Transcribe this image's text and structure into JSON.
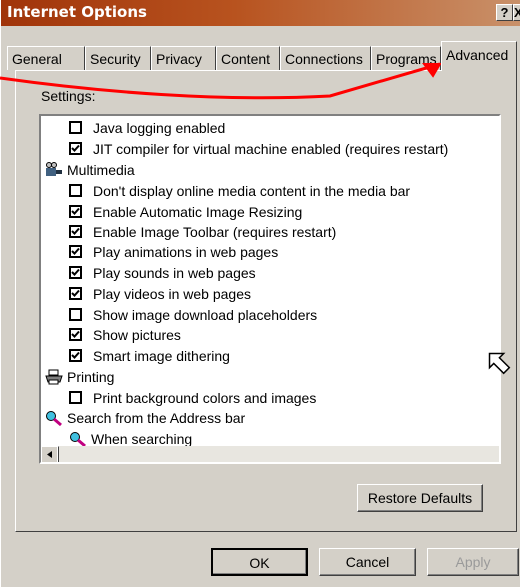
{
  "window": {
    "title": "Internet Options",
    "help_label": "?",
    "close_label": "X"
  },
  "tabs": [
    {
      "label": "General"
    },
    {
      "label": "Security"
    },
    {
      "label": "Privacy"
    },
    {
      "label": "Content"
    },
    {
      "label": "Connections"
    },
    {
      "label": "Programs"
    },
    {
      "label": "Advanced"
    }
  ],
  "active_tab": "Advanced",
  "settings_label": "Settings:",
  "settings_list": [
    {
      "label": "Java logging enabled",
      "checked": false
    },
    {
      "label": "JIT compiler for virtual machine enabled (requires restart)",
      "checked": true
    },
    {
      "label": "Multimedia",
      "category": true,
      "icon": "multimedia-icon"
    },
    {
      "label": "Don't display online media content in the media bar",
      "checked": false
    },
    {
      "label": "Enable Automatic Image Resizing",
      "checked": true
    },
    {
      "label": "Enable Image Toolbar (requires restart)",
      "checked": true
    },
    {
      "label": "Play animations in web pages",
      "checked": true
    },
    {
      "label": "Play sounds in web pages",
      "checked": true
    },
    {
      "label": "Play videos in web pages",
      "checked": true
    },
    {
      "label": "Show image download placeholders",
      "checked": false
    },
    {
      "label": "Show pictures",
      "checked": true
    },
    {
      "label": "Smart image dithering",
      "checked": true
    },
    {
      "label": "Printing",
      "category": true,
      "icon": "printer-icon"
    },
    {
      "label": "Print background colors and images",
      "checked": false
    },
    {
      "label": "Search from the Address bar",
      "category": true,
      "icon": "search-icon"
    },
    {
      "label": "When searching",
      "subcategory": true,
      "icon": "search-icon"
    }
  ],
  "buttons": {
    "restore_defaults": "Restore Defaults",
    "ok": "OK",
    "cancel": "Cancel",
    "apply": "Apply"
  },
  "colors": {
    "title_bar": "#a0340a",
    "annotation_arrow": "#ff0000",
    "dialog_bg": "#d4d0c8"
  }
}
